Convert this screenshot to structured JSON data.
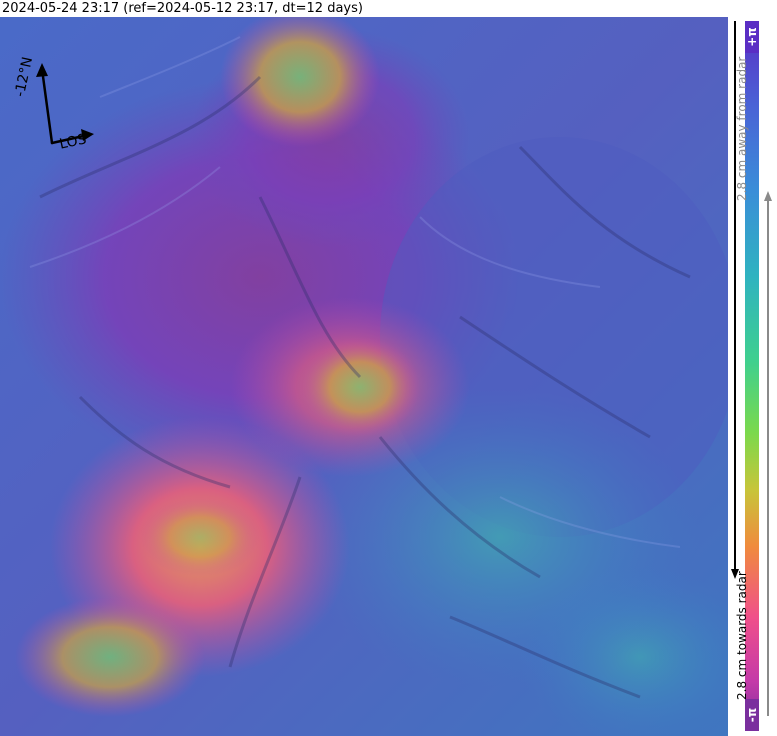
{
  "title": "2024-05-24 23:17 (ref=2024-05-12 23:17, dt=12 days)",
  "compass": {
    "north_label": "-12°N",
    "los_label": "LOS",
    "rotation_deg": -12
  },
  "colorbar": {
    "top_end": "+π",
    "bottom_end": "-π",
    "away_label": "2.8 cm away from radar",
    "towards_label": "2.8 cm towards radar",
    "colors_top_to_bottom": [
      "#5a2ec4",
      "#4a63d6",
      "#3a8ed8",
      "#2fb3c0",
      "#3fd08e",
      "#7bd94c",
      "#c7c53a",
      "#f08b3d",
      "#f0508a",
      "#c43aa8",
      "#7a2f9e"
    ]
  },
  "map": {
    "base_color": "#4a5ab8",
    "deformation_colors": [
      "#c24aa8",
      "#e8607a",
      "#f0a050",
      "#6fd07a",
      "#3ab0c0"
    ]
  }
}
